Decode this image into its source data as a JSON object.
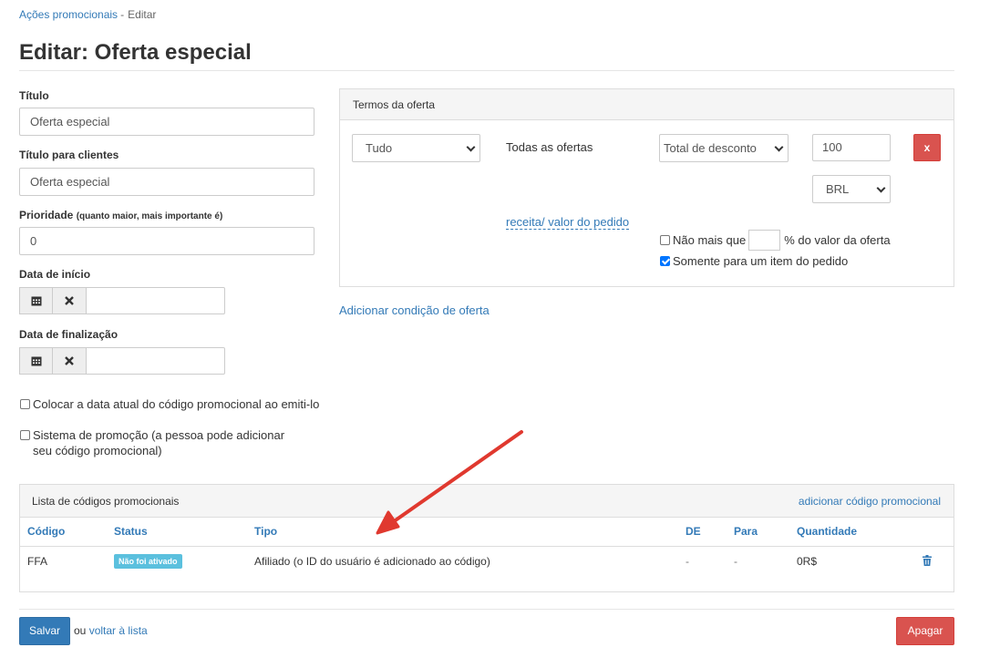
{
  "breadcrumb": {
    "parent": "Ações promocionais",
    "separator": "-",
    "current": "Editar"
  },
  "page_title": "Editar: Oferta especial",
  "form": {
    "title_label": "Título",
    "title_value": "Oferta especial",
    "client_title_label": "Título para clientes",
    "client_title_value": "Oferta especial",
    "priority_label": "Prioridade",
    "priority_hint": "(quanto maior, mais importante é)",
    "priority_value": "0",
    "start_date_label": "Data de início",
    "end_date_label": "Data de finalização",
    "check_current_date": "Colocar a data atual do código promocional ao emiti-lo",
    "check_promo_system": "Sistema de promoção (a pessoa pode adicionar seu código promocional)"
  },
  "offer_terms": {
    "heading": "Termos da oferta",
    "scope_select": "Tudo",
    "all_offers_text": "Todas as ofertas",
    "discount_type_select": "Total de desconto",
    "amount_value": "100",
    "currency_select": "BRL",
    "remove_label": "x",
    "revenue_link": "receita/ valor do pedido",
    "not_more_than_prefix": "Não mais que",
    "not_more_than_suffix": "% do valor da oferta",
    "only_one_item": "Somente para um item do pedido",
    "add_condition_link": "Adicionar condição de oferta"
  },
  "promo_codes": {
    "heading": "Lista de códigos promocionais",
    "add_link": "adicionar código promocional",
    "columns": [
      "Código",
      "Status",
      "Tipo",
      "DE",
      "Para",
      "Quantidade"
    ],
    "rows": [
      {
        "code": "FFA",
        "status": "Não foi ativado",
        "type": "Afiliado (o ID do usuário é adicionado ao código)",
        "from": "-",
        "to": "-",
        "quantity": "0R$"
      }
    ]
  },
  "footer": {
    "save_label": "Salvar",
    "or_text": "ou",
    "back_link": "voltar à lista",
    "delete_label": "Apagar"
  },
  "colors": {
    "primary": "#337ab7",
    "danger": "#d9534f",
    "info_badge": "#5bc0de",
    "annotation_arrow": "#e0392f"
  }
}
